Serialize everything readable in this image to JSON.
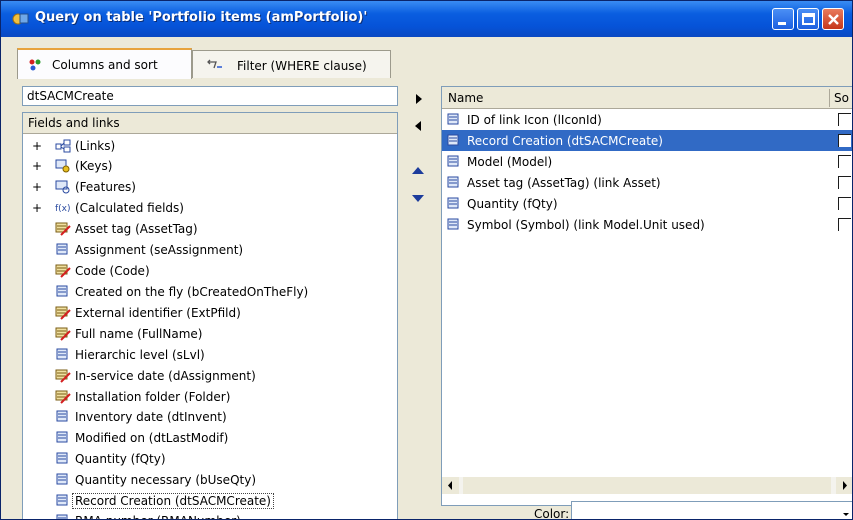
{
  "window": {
    "title": "Query on table 'Portfolio items (amPortfolio)'"
  },
  "tabs": [
    {
      "label": "Columns and sort",
      "active": true,
      "icon": "columns-icon"
    },
    {
      "label": "Filter (WHERE clause)",
      "active": false,
      "icon": "filter-icon"
    }
  ],
  "left": {
    "search_value": "dtSACMCreate",
    "tree_header": "Fields and links",
    "tree_items": [
      {
        "label": "(Links)",
        "icon": "links-icon",
        "expandable": true
      },
      {
        "label": "(Keys)",
        "icon": "keys-icon",
        "expandable": true
      },
      {
        "label": "(Features)",
        "icon": "features-icon",
        "expandable": true
      },
      {
        "label": "(Calculated fields)",
        "icon": "calculated-fields-icon",
        "expandable": true
      },
      {
        "label": "Asset tag (AssetTag)",
        "icon": "indexed-field-icon"
      },
      {
        "label": "Assignment (seAssignment)",
        "icon": "field-icon"
      },
      {
        "label": "Code (Code)",
        "icon": "indexed-field-icon"
      },
      {
        "label": "Created on the fly (bCreatedOnTheFly)",
        "icon": "field-icon"
      },
      {
        "label": "External identifier (ExtPfild)",
        "icon": "indexed-field-icon"
      },
      {
        "label": "Full name (FullName)",
        "icon": "indexed-field-icon"
      },
      {
        "label": "Hierarchic level (sLvl)",
        "icon": "field-icon"
      },
      {
        "label": "In-service date (dAssignment)",
        "icon": "indexed-field-icon"
      },
      {
        "label": "Installation folder (Folder)",
        "icon": "indexed-field-icon"
      },
      {
        "label": "Inventory date (dtInvent)",
        "icon": "field-icon"
      },
      {
        "label": "Modified on (dtLastModif)",
        "icon": "field-icon"
      },
      {
        "label": "Quantity (fQty)",
        "icon": "field-icon"
      },
      {
        "label": "Quantity necessary (bUseQty)",
        "icon": "field-icon"
      },
      {
        "label": "Record Creation (dtSACMCreate)",
        "icon": "field-icon",
        "selected": true
      },
      {
        "label": "RMA number (RMANumber)",
        "icon": "field-icon"
      }
    ]
  },
  "right": {
    "header_name": "Name",
    "header_sort": "So",
    "items": [
      {
        "label": "ID of link Icon (lIconId)"
      },
      {
        "label": "Record Creation (dtSACMCreate)",
        "selected": true
      },
      {
        "label": "Model (Model)"
      },
      {
        "label": "Asset tag (AssetTag) (link Asset)"
      },
      {
        "label": "Quantity (fQty)"
      },
      {
        "label": "Symbol (Symbol) (link Model.Unit used)"
      }
    ],
    "color_label": "Color:"
  },
  "colors": {
    "titlebar": "#0a5ee0",
    "selection": "#316ac5",
    "tab_accent": "#e8a33c"
  }
}
